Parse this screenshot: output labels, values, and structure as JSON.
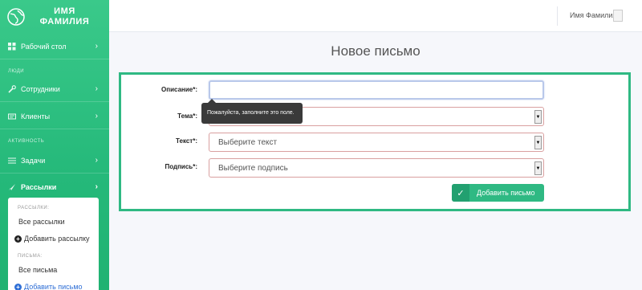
{
  "sidebar": {
    "brand_line1": "ИМЯ",
    "brand_line2": "ФАМИЛИЯ",
    "items": [
      {
        "label": "Рабочий стол"
      },
      {
        "section": "ЛЮДИ"
      },
      {
        "label": "Сотрудники"
      },
      {
        "label": "Клиенты"
      },
      {
        "section": "АКТИВНОСТЬ"
      },
      {
        "label": "Задачи"
      },
      {
        "label": "Рассылки"
      }
    ],
    "submenu": {
      "head1": "РАССЫЛКИ:",
      "item1": "Все рассылки",
      "item2": "Добавить рассылку",
      "head2": "ПИСЬМА:",
      "item3": "Все письма",
      "item4": "Добавить письмо"
    }
  },
  "topbar": {
    "user_name": "Имя Фамилия"
  },
  "page": {
    "title": "Новое письмо"
  },
  "form": {
    "description_label": "Описание*:",
    "description_value": "",
    "topic_label": "Тема*:",
    "text_label": "Текст*:",
    "text_placeholder": "Выберите текст",
    "signature_label": "Подпись*:",
    "signature_placeholder": "Выберите подпись",
    "tooltip": "Пожалуйста, заполните это поле.",
    "submit_label": "Добавить письмо"
  },
  "colors": {
    "accent": "#2fb983",
    "sidebar": "#25b97a",
    "invalid_border": "#d9a0a0"
  }
}
